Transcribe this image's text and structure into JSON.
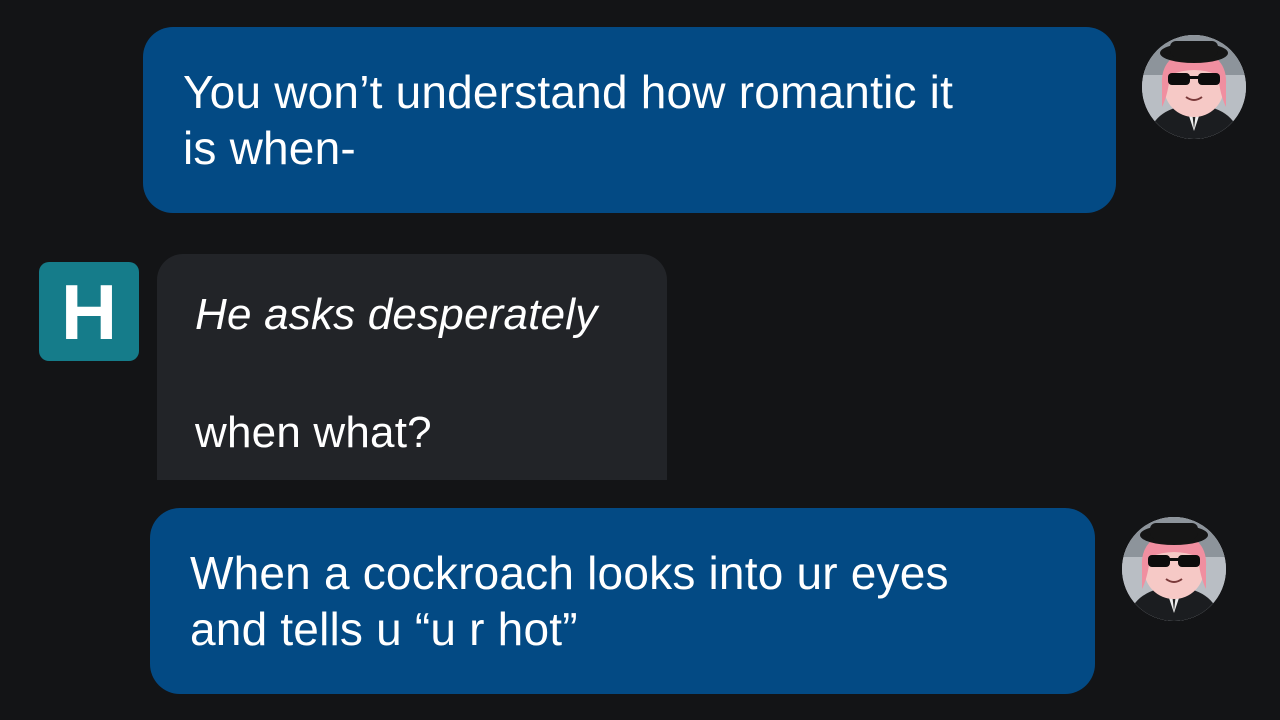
{
  "messages": [
    {
      "role": "user",
      "lines": [
        "You won’t understand how romantic it",
        "is when-"
      ]
    },
    {
      "role": "character",
      "narration": "He asks desperately",
      "reply": "when what?"
    },
    {
      "role": "user",
      "lines": [
        "When a cockroach looks into ur eyes",
        "and tells u “u r hot”"
      ]
    }
  ],
  "character": {
    "initial": "H",
    "badge_color": "#157c8a"
  },
  "colors": {
    "background": "#131416",
    "user_bubble": "#034a84",
    "character_bubble": "#222428",
    "text": "#ffffff"
  },
  "icons": {
    "user_avatar": "anime-girl-sunglasses-avatar",
    "character_avatar": "letter-h-badge"
  }
}
